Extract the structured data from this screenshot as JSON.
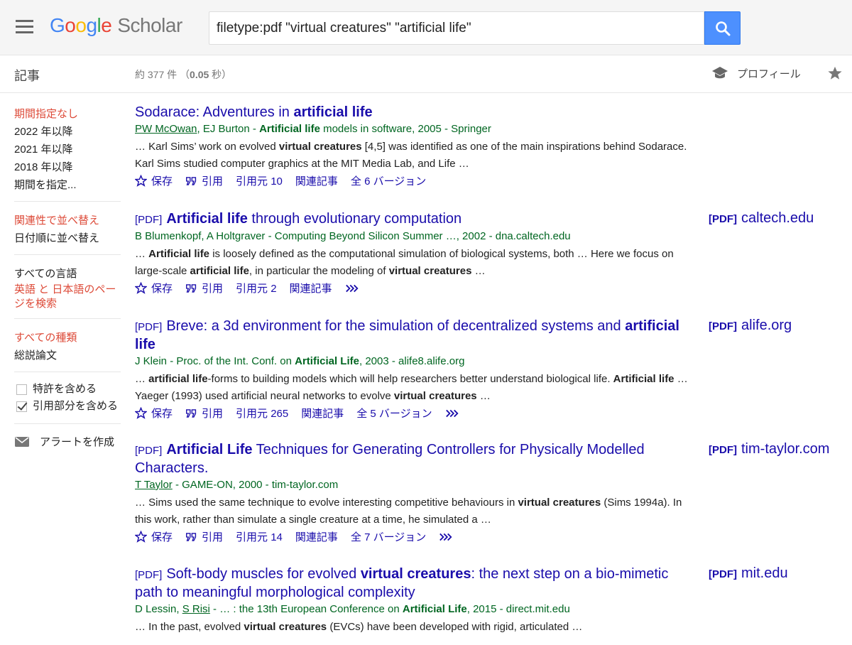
{
  "header": {
    "logo_google": [
      "G",
      "o",
      "o",
      "g",
      "l",
      "e"
    ],
    "logo_scholar": "Scholar",
    "search_value": "filetype:pdf \"virtual creatures\" \"artificial life\""
  },
  "subbar": {
    "section": "記事",
    "count_prefix": "約 377 件 （",
    "count_time": "0.05",
    "count_suffix": " 秒）",
    "profile": "プロフィール"
  },
  "sidebar": {
    "period": [
      "期間指定なし",
      "2022 年以降",
      "2021 年以降",
      "2018 年以降",
      "期間を指定..."
    ],
    "sort": [
      "関連性で並べ替え",
      "日付順に並べ替え"
    ],
    "language": [
      "すべての言語",
      "英語 と 日本語のページを検索"
    ],
    "type": [
      "すべての種類",
      "総説論文"
    ],
    "include_patents": "特許を含める",
    "include_citations": "引用部分を含める",
    "alert": "アラートを作成"
  },
  "actions": {
    "save": "保存",
    "cite": "引用",
    "related": "関連記事"
  },
  "results": [
    {
      "title_parts": [
        [
          "Sodarace: Adventures in ",
          false
        ],
        [
          "artificial life",
          true
        ]
      ],
      "meta_parts": [
        [
          "PW McOwan",
          false,
          true
        ],
        [
          ", EJ Burton - ",
          false,
          false
        ],
        [
          "Artificial life",
          true,
          false
        ],
        [
          " models in software, 2005 - Springer",
          false,
          false
        ]
      ],
      "snippet": [
        [
          "… Karl Sims’ work on evolved ",
          false
        ],
        [
          "virtual creatures",
          true
        ],
        [
          " [4,5] was identified as one of the main inspirations behind Sodarace. Karl Sims studied computer graphics at the MIT Media Lab, and Life …",
          false
        ]
      ],
      "cited_by": "引用元 10",
      "versions": "全 6 バージョン"
    },
    {
      "tag": "[PDF]",
      "title_parts": [
        [
          "Artificial life",
          true
        ],
        [
          " through evolutionary computation",
          false
        ]
      ],
      "meta_parts": [
        [
          "B Blumenkopf, A Holtgraver - Computing Beyond Silicon Summer …, 2002 - dna.caltech.edu",
          false,
          false
        ]
      ],
      "snippet": [
        [
          "… ",
          false
        ],
        [
          "Artificial life",
          true
        ],
        [
          " is loosely defined as the computational simulation of biological systems, both … Here we focus on large-scale ",
          false
        ],
        [
          "artificial life",
          true
        ],
        [
          ", in particular the modeling of ",
          false
        ],
        [
          "virtual creatures",
          true
        ],
        [
          " …",
          false
        ]
      ],
      "cited_by": "引用元 2",
      "right_tag": "[PDF]",
      "right_domain": "caltech.edu"
    },
    {
      "tag": "[PDF]",
      "title_parts": [
        [
          "Breve: a 3d environment for the simulation of decentralized systems and ",
          false
        ],
        [
          "artificial life",
          true
        ]
      ],
      "meta_parts": [
        [
          "J Klein - Proc. of the Int. Conf. on ",
          false,
          false
        ],
        [
          "Artificial Life",
          true,
          false
        ],
        [
          ", 2003 - alife8.alife.org",
          false,
          false
        ]
      ],
      "snippet": [
        [
          "… ",
          false
        ],
        [
          "artificial life",
          true
        ],
        [
          "-forms to building models which will help researchers better understand biological life. ",
          false
        ],
        [
          "Artificial life",
          true
        ],
        [
          " … Yaeger (1993) used artificial neural networks to evolve ",
          false
        ],
        [
          "virtual creatures",
          true
        ],
        [
          " …",
          false
        ]
      ],
      "cited_by": "引用元 265",
      "versions": "全 5 バージョン",
      "right_tag": "[PDF]",
      "right_domain": "alife.org"
    },
    {
      "tag": "[PDF]",
      "title_parts": [
        [
          "Artificial Life",
          true
        ],
        [
          " Techniques for Generating Controllers for Physically Modelled Characters.",
          false
        ]
      ],
      "meta_parts": [
        [
          "T Taylor",
          false,
          true
        ],
        [
          " - GAME-ON, 2000 - tim-taylor.com",
          false,
          false
        ]
      ],
      "snippet": [
        [
          "… Sims used the same technique to evolve interesting competitive behaviours in ",
          false
        ],
        [
          "virtual creatures",
          true
        ],
        [
          " (Sims 1994a). In this work, rather than simulate a single creature at a time, he simulated a …",
          false
        ]
      ],
      "cited_by": "引用元 14",
      "versions": "全 7 バージョン",
      "right_tag": "[PDF]",
      "right_domain": "tim-taylor.com"
    },
    {
      "tag": "[PDF]",
      "title_parts": [
        [
          "Soft-body muscles for evolved ",
          false
        ],
        [
          "virtual creatures",
          true
        ],
        [
          ": the next step on a bio-mimetic path to meaningful morphological complexity",
          false
        ]
      ],
      "meta_parts": [
        [
          "D Lessin, ",
          false,
          false
        ],
        [
          "S Risi",
          false,
          true
        ],
        [
          " - … : the 13th European Conference on ",
          false,
          false
        ],
        [
          "Artificial Life",
          true,
          false
        ],
        [
          ", 2015 - direct.mit.edu",
          false,
          false
        ]
      ],
      "snippet": [
        [
          "… In the past, evolved ",
          false
        ],
        [
          "virtual creatures",
          true
        ],
        [
          " (EVCs) have been developed with rigid, articulated …",
          false
        ]
      ],
      "right_tag": "[PDF]",
      "right_domain": "mit.edu"
    }
  ]
}
